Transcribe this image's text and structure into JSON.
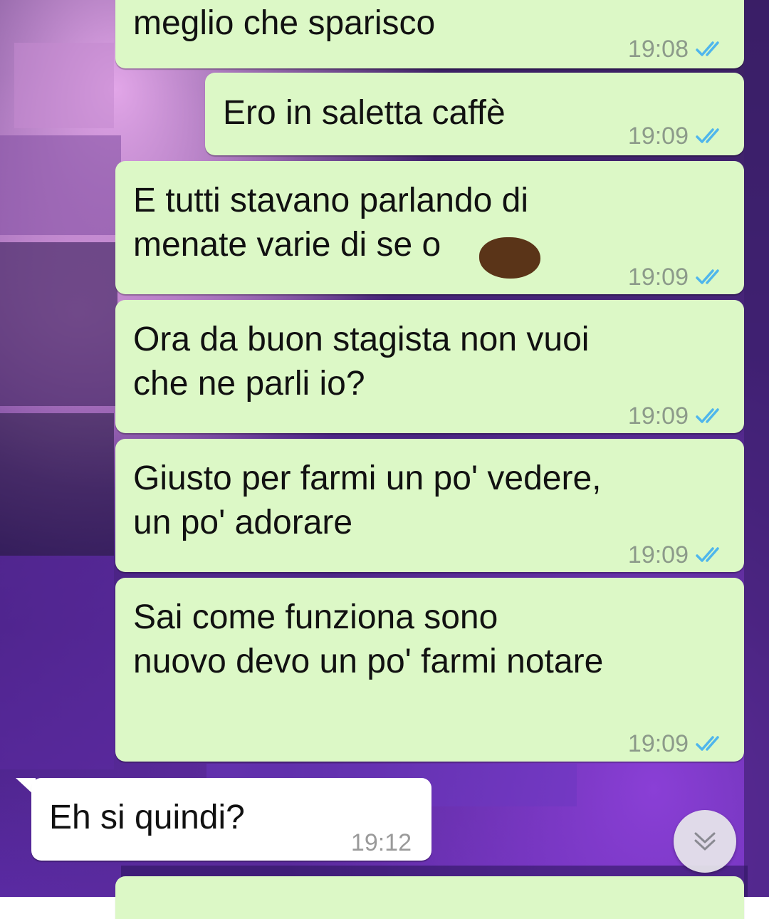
{
  "messages": [
    {
      "text": "meglio che sparisco",
      "time": "19:08",
      "direction": "out",
      "status": "read"
    },
    {
      "text": "Ero in saletta caffè",
      "time": "19:09",
      "direction": "out",
      "status": "read"
    },
    {
      "text": "E tutti stavano parlando di\nmenate varie di se   o",
      "time": "19:09",
      "direction": "out",
      "status": "read"
    },
    {
      "text": "Ora da buon stagista non vuoi\nche ne parli io?",
      "time": "19:09",
      "direction": "out",
      "status": "read"
    },
    {
      "text": "Giusto per farmi un po' vedere,\nun po' adorare",
      "time": "19:09",
      "direction": "out",
      "status": "read"
    },
    {
      "text": "Sai come funziona sono\nnuovo devo un po' farmi notare",
      "time": "19:09",
      "direction": "out",
      "status": "read"
    },
    {
      "text": "Eh si quindi?",
      "time": "19:12",
      "direction": "in"
    }
  ],
  "colors": {
    "outgoing_bubble": "#dcf8c6",
    "incoming_bubble": "#ffffff",
    "read_ticks": "#4fb6ec",
    "timestamp": "#8c9a8a"
  },
  "icons": {
    "read_receipt": "double-check-icon",
    "scroll_down": "double-chevron-down-icon"
  }
}
